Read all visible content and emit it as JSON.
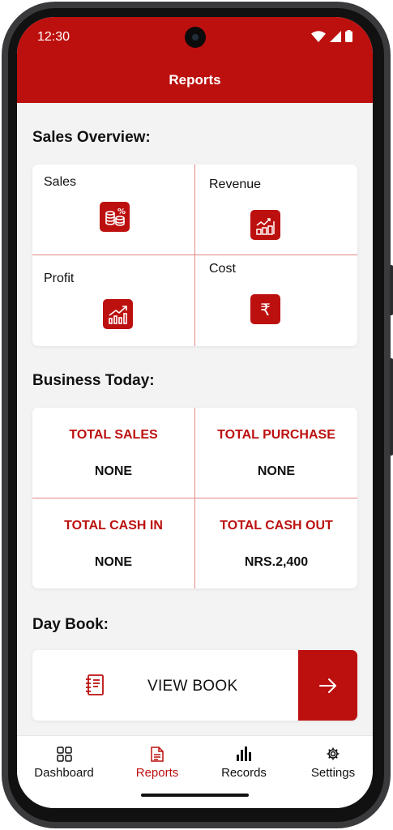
{
  "status_bar": {
    "time": "12:30"
  },
  "header": {
    "title": "Reports"
  },
  "sales_overview": {
    "title": "Sales Overview:",
    "items": [
      {
        "label": "Sales",
        "icon": "coins-percent-icon"
      },
      {
        "label": "Revenue",
        "icon": "revenue-chart-icon"
      },
      {
        "label": "Profit",
        "icon": "profit-chart-icon"
      },
      {
        "label": "Cost",
        "icon": "rupee-icon"
      }
    ]
  },
  "business_today": {
    "title": "Business Today:",
    "items": [
      {
        "title": "TOTAL SALES",
        "value": "NONE"
      },
      {
        "title": "TOTAL PURCHASE",
        "value": "NONE"
      },
      {
        "title": "TOTAL CASH IN",
        "value": "NONE"
      },
      {
        "title": "TOTAL CASH OUT",
        "value": "NRS.2,400"
      }
    ]
  },
  "day_book": {
    "title": "Day Book:",
    "button_label": "VIEW BOOK"
  },
  "bottom_nav": {
    "items": [
      {
        "label": "Dashboard",
        "icon": "grid-icon"
      },
      {
        "label": "Reports",
        "icon": "document-icon",
        "active": true
      },
      {
        "label": "Records",
        "icon": "bar-chart-icon"
      },
      {
        "label": "Settings",
        "icon": "gear-icon"
      }
    ]
  },
  "colors": {
    "accent": "#bc100f",
    "background": "#f3f3f3",
    "divider": "#e48686"
  }
}
